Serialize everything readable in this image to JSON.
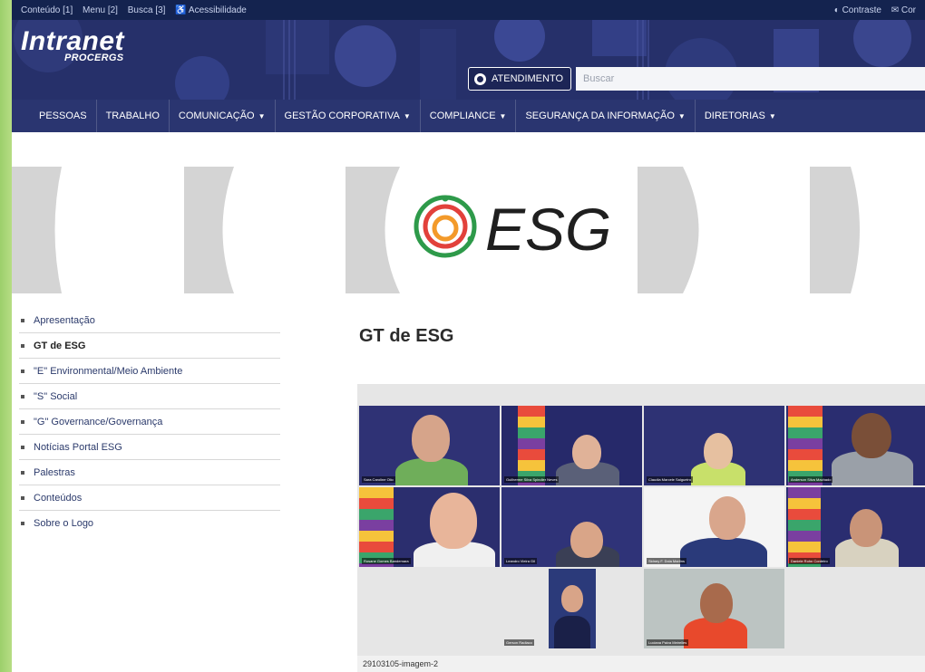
{
  "accbar": {
    "links": [
      "Conteúdo [1]",
      "Menu [2]",
      "Busca [3]",
      "♿ Acessibilidade"
    ],
    "right": [
      "◐ Contraste",
      "✉ Cor"
    ]
  },
  "header": {
    "logo_main": "Intranet",
    "logo_sub": "PROCERGS",
    "atendimento_label": "ATENDIMENTO",
    "search_placeholder": "Buscar"
  },
  "nav": {
    "items": [
      {
        "label": "PESSOAS",
        "dropdown": false
      },
      {
        "label": "TRABALHO",
        "dropdown": false
      },
      {
        "label": "COMUNICAÇÃO",
        "dropdown": true
      },
      {
        "label": "GESTÃO CORPORATIVA",
        "dropdown": true
      },
      {
        "label": "COMPLIANCE",
        "dropdown": true
      },
      {
        "label": "SEGURANÇA DA INFORMAÇÃO",
        "dropdown": true
      },
      {
        "label": "DIRETORIAS",
        "dropdown": true
      }
    ]
  },
  "banner": {
    "text": "ESG"
  },
  "sidebar": {
    "items": [
      {
        "label": "Apresentação",
        "active": false
      },
      {
        "label": "GT de ESG",
        "active": true
      },
      {
        "label": "\"E\" Environmental/Meio Ambiente",
        "active": false
      },
      {
        "label": "\"S\" Social",
        "active": false
      },
      {
        "label": "\"G\" Governance/Governança",
        "active": false
      },
      {
        "label": "Notícias Portal ESG",
        "active": false
      },
      {
        "label": "Palestras",
        "active": false
      },
      {
        "label": "Conteúdos",
        "active": false
      },
      {
        "label": "Sobre o Logo",
        "active": false
      }
    ]
  },
  "main": {
    "title": "GT de ESG",
    "image_caption": "29103105-imagem-2",
    "participants": [
      "Sara Caroline Olio",
      "Guilherme Silva Spindler Neves",
      "Claudia Marcele Salgueiro",
      "Anderson Silva Machado",
      "Rosane Gomes Bandemara",
      "Leandro Vieira Gil",
      "Sidney F. Dola Martins",
      "Daniele Rohn Cordeiro",
      "Gerson Radiaco",
      "Luciana Paiva Meirelles"
    ]
  },
  "colors": {
    "header_bg": "#26306a",
    "accbar_bg": "#14234f",
    "nav_text": "#ffffff",
    "esg_green": "#2e9a4a",
    "esg_orange": "#f39a2a",
    "esg_red": "#e2413b"
  }
}
